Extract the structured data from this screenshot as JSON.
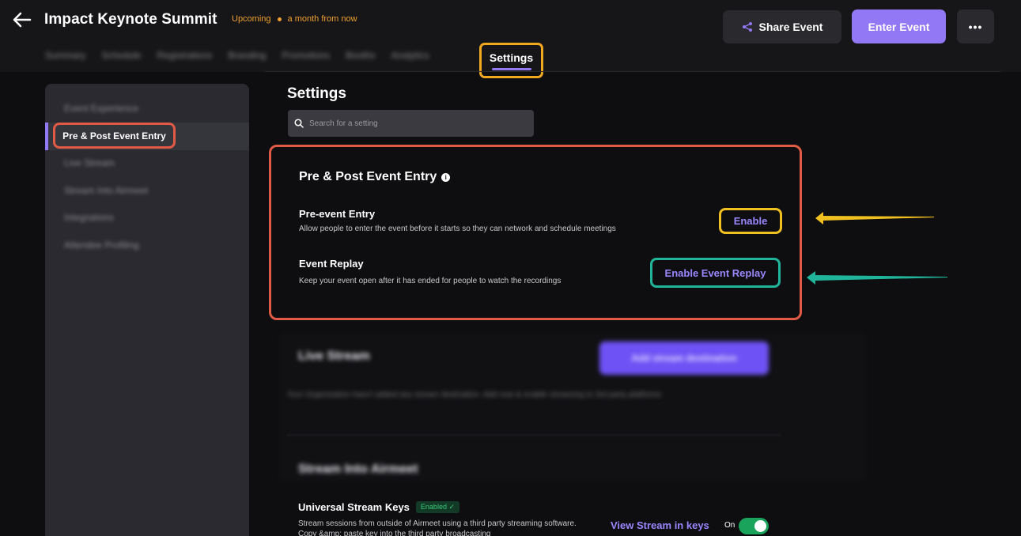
{
  "header": {
    "title": "Impact Keynote Summit",
    "status": "Upcoming",
    "time": "a month from now",
    "share_label": "Share Event",
    "enter_label": "Enter Event",
    "more_label": "•••"
  },
  "tabs": {
    "items": [
      "Summary",
      "Schedule",
      "Registrations",
      "Branding",
      "Promotions",
      "Booths",
      "Analytics"
    ],
    "active": "Settings"
  },
  "sidebar": {
    "items": [
      "Event Experience",
      "Pre & Post Event Entry",
      "Live Stream",
      "Stream Into Airmeet",
      "Integrations",
      "Attendee Profiling"
    ],
    "active_index": 1
  },
  "main": {
    "heading": "Settings",
    "search_placeholder": "Search for a setting"
  },
  "pre_post": {
    "title": "Pre & Post Event Entry",
    "pre_title": "Pre-event Entry",
    "pre_desc": "Allow people to enter the event before it starts so they can network and schedule meetings",
    "pre_button": "Enable",
    "replay_title": "Event Replay",
    "replay_desc": "Keep your event open after it has ended for people to watch the recordings",
    "replay_button": "Enable Event Replay"
  },
  "live_stream": {
    "title": "Live Stream",
    "button": "Add stream destination",
    "desc": "Your Organization hasn't added any stream destination. Add now & enable streaming to 3rd party platforms"
  },
  "stream_into": {
    "title": "Stream Into Airmeet",
    "usk_title": "Universal Stream Keys",
    "usk_badge": "Enabled ✓",
    "usk_desc": "Stream sessions from outside of Airmeet using a third party streaming software. Copy &amp; paste key into the third party broadcasting",
    "view_keys": "View Stream in keys",
    "toggle_label": "On",
    "toggle_on": true
  },
  "colors": {
    "accent": "#9378f5",
    "highlight_orange": "#f0a820",
    "highlight_red": "#e05a45",
    "highlight_yellow": "#f0c020",
    "highlight_teal": "#20b49a",
    "status_orange": "#f0a030"
  }
}
